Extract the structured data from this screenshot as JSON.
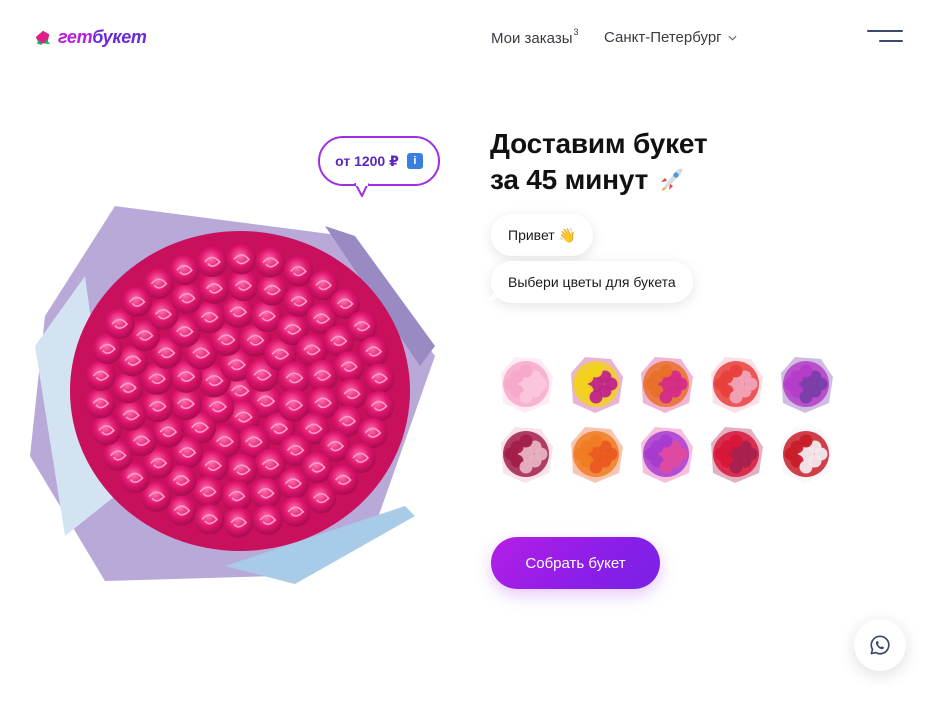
{
  "header": {
    "logo_get": "гет",
    "logo_buket": "букет",
    "orders_label": "Мои заказы",
    "orders_count": "3",
    "city_label": "Санкт-Петербург",
    "menu_icon": "hamburger-icon"
  },
  "hero": {
    "price_label": "от 1200 ₽",
    "price_icon": "info-icon",
    "headline_line1": "Доставим букет",
    "headline_line2": "за 45 минут",
    "headline_icon": "rocket-icon"
  },
  "chat": {
    "greeting": "Привет",
    "greeting_icon": "waving-hand-icon",
    "prompt": "Выбери цветы для букета"
  },
  "bouquet_thumbnails": [
    {
      "name": "pink-roses",
      "colors": [
        "#f6a9c9",
        "#fbc6dc"
      ]
    },
    {
      "name": "yellow-roses",
      "colors": [
        "#f2d21c",
        "#c0248a"
      ]
    },
    {
      "name": "mixed-orange-pink",
      "colors": [
        "#e8702a",
        "#d42b8a"
      ]
    },
    {
      "name": "mixed-pastel",
      "colors": [
        "#e8403a",
        "#f2a2b8"
      ]
    },
    {
      "name": "purple-chrysanthemums",
      "colors": [
        "#b53cc6",
        "#7a3ea8"
      ]
    },
    {
      "name": "dark-mixed",
      "colors": [
        "#a21f4a",
        "#e8b0c0"
      ]
    },
    {
      "name": "orange-roses",
      "colors": [
        "#f07b22",
        "#e95a20"
      ]
    },
    {
      "name": "purple-mix",
      "colors": [
        "#a83ad0",
        "#e04aa0"
      ]
    },
    {
      "name": "red-roses",
      "colors": [
        "#d8163a",
        "#a8204e"
      ]
    },
    {
      "name": "red-white-mix",
      "colors": [
        "#c81e2a",
        "#f2e8ec"
      ]
    }
  ],
  "cta": {
    "label": "Собрать букет"
  },
  "whatsapp": {
    "icon": "whatsapp-icon"
  },
  "colors": {
    "accent": "#9a1ee8",
    "brand_pink": "#e0238a",
    "text": "#1b1b1f"
  }
}
